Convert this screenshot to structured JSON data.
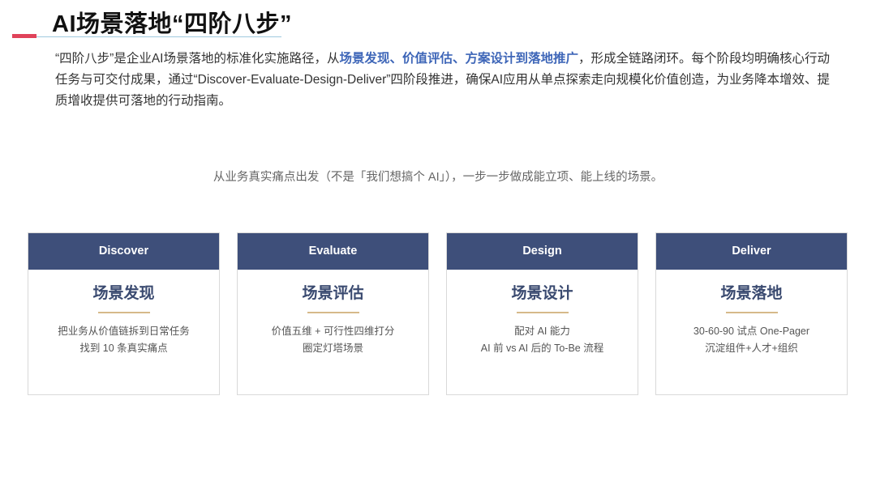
{
  "title": "AI场景落地“四阶八步”",
  "intro": {
    "part1": "“四阶八步”是企业AI场景落地的标准化实施路径，从",
    "highlight": "场景发现、价值评估、方案设计到落地推广",
    "part2": "，形成全链路闭环。每个阶段均明确核心行动任务与可交付成果，通过“Discover-Evaluate-Design-Deliver”四阶段推进，确保AI应用从单点探索走向规模化价值创造，为业务降本增效、提质增收提供可落地的行动指南。"
  },
  "subtitle": "从业务真实痛点出发（不是「我们想搞个 AI」），一步一步做成能立项、能上线的场景。",
  "cards": [
    {
      "header": "Discover",
      "title": "场景发现",
      "line1": "把业务从价值链拆到日常任务",
      "line2": "找到 10 条真实痛点"
    },
    {
      "header": "Evaluate",
      "title": "场景评估",
      "line1": "价值五维 + 可行性四维打分",
      "line2": "圈定灯塔场景"
    },
    {
      "header": "Design",
      "title": "场景设计",
      "line1": "配对 AI 能力",
      "line2": "AI 前 vs AI 后的 To-Be 流程"
    },
    {
      "header": "Deliver",
      "title": "场景落地",
      "line1": "30-60-90 试点 One-Pager",
      "line2": "沉淀组件+人才+组织"
    }
  ],
  "colors": {
    "accent_red": "#e0435a",
    "highlight_blue": "#3e66b8",
    "card_header_navy": "#3e4f7a",
    "divider_gold": "#d6b98a"
  }
}
